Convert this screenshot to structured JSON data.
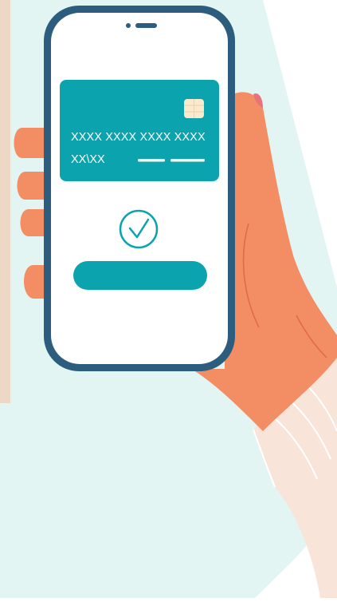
{
  "card": {
    "number": "XXXX XXXX XXXX XXXX",
    "expiry": "XX\\XX"
  },
  "icons": {
    "status": "check-circle-icon",
    "chip": "card-chip-icon",
    "speaker": "speaker-icon"
  },
  "colors": {
    "teal": "#0ba3ae",
    "phone_frame": "#2c5d7e",
    "skin": "#f38d63",
    "sleeve": "#f9e4da",
    "background_mint": "#e2f5f3",
    "background_beige": "#ecd8c4"
  }
}
